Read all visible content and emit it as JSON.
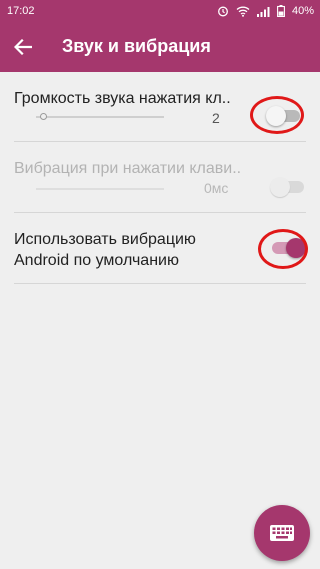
{
  "status_bar": {
    "time": "17:02",
    "battery": "40%",
    "icons": [
      "alarm-icon",
      "wifi-icon",
      "signal-icon",
      "battery-icon"
    ]
  },
  "toolbar": {
    "title": "Звук и вибрация",
    "back_icon": "back-arrow-icon"
  },
  "settings": {
    "keypress_volume": {
      "title": "Громкость звука нажатия кл..",
      "value": "2",
      "toggle_on": false
    },
    "keypress_vibration": {
      "title": "Вибрация при нажатии клави..",
      "value": "0мс",
      "toggle_on": false,
      "enabled": false
    },
    "default_vibration": {
      "title": "Использовать вибрацию Android по умолчанию",
      "toggle_on": true
    }
  },
  "fab": {
    "icon": "keyboard-icon"
  },
  "colors": {
    "accent": "#a5376d",
    "annotation_ring": "#e01818",
    "background": "#efefef"
  }
}
